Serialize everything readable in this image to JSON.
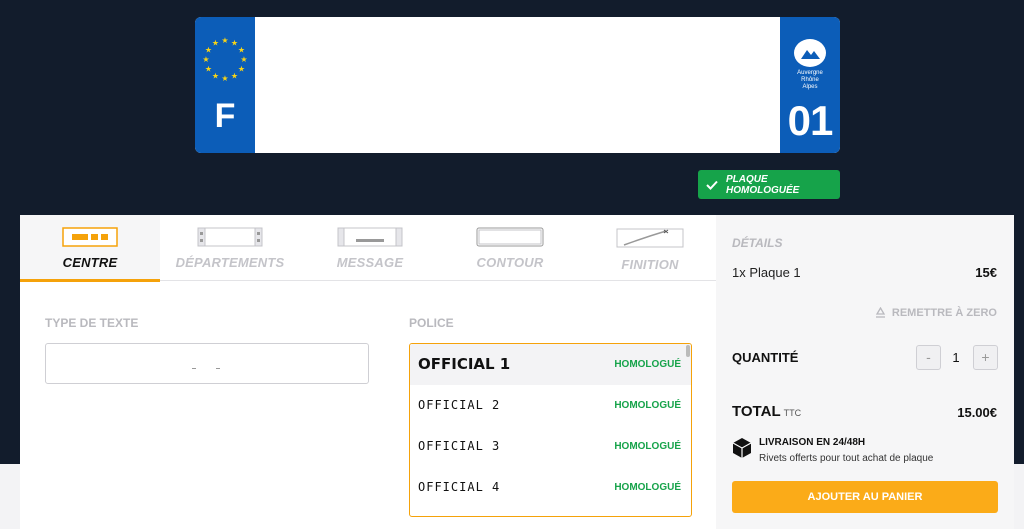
{
  "plate": {
    "country_letter": "F",
    "region_name_lines": [
      "Auvergne",
      "Rhône",
      "Alpes"
    ],
    "department_number": "01",
    "colors": {
      "band": "#0c5db8",
      "stars": "#f7d417"
    }
  },
  "badge": {
    "label": "PLAQUE HOMOLOGUÉE",
    "icon": "check-icon",
    "color": "#16a34a"
  },
  "tabs": [
    {
      "label": "CENTRE",
      "icon": "center-text-icon",
      "active": true
    },
    {
      "label": "DÉPARTEMENTS",
      "icon": "department-band-icon",
      "active": false
    },
    {
      "label": "MESSAGE",
      "icon": "message-icon",
      "active": false
    },
    {
      "label": "CONTOUR",
      "icon": "outline-icon",
      "active": false
    },
    {
      "label": "FINITION",
      "icon": "finish-icon",
      "active": false
    }
  ],
  "text_type": {
    "label": "TYPE DE TEXTE",
    "value": ""
  },
  "font": {
    "label": "POLICE",
    "options": [
      {
        "name": "OFFICIAL 1",
        "status": "HOMOLOGUÉ",
        "selected": true
      },
      {
        "name": "OFFICIAL 2",
        "status": "HOMOLOGUÉ",
        "selected": false
      },
      {
        "name": "OFFICIAL 3",
        "status": "HOMOLOGUÉ",
        "selected": false
      },
      {
        "name": "OFFICIAL 4",
        "status": "HOMOLOGUÉ",
        "selected": false
      }
    ]
  },
  "details": {
    "heading": "DÉTAILS",
    "line_item": "1x Plaque 1",
    "line_price": "15€",
    "reset_label": "REMETTRE À ZERO",
    "quantity_label": "QUANTITÉ",
    "quantity": "1",
    "minus": "-",
    "plus": "+",
    "total_label": "TOTAL",
    "total_suffix": "TTC",
    "total_value": "15.00€",
    "delivery_title": "LIVRAISON EN 24/48H",
    "delivery_sub": "Rivets offerts pour tout achat de plaque",
    "add_to_cart": "AJOUTER AU PANIER"
  },
  "colors": {
    "accent": "#f5a20a",
    "button": "#fbab18",
    "hero_bg": "#121c2c",
    "ok_green": "#16a34a"
  }
}
